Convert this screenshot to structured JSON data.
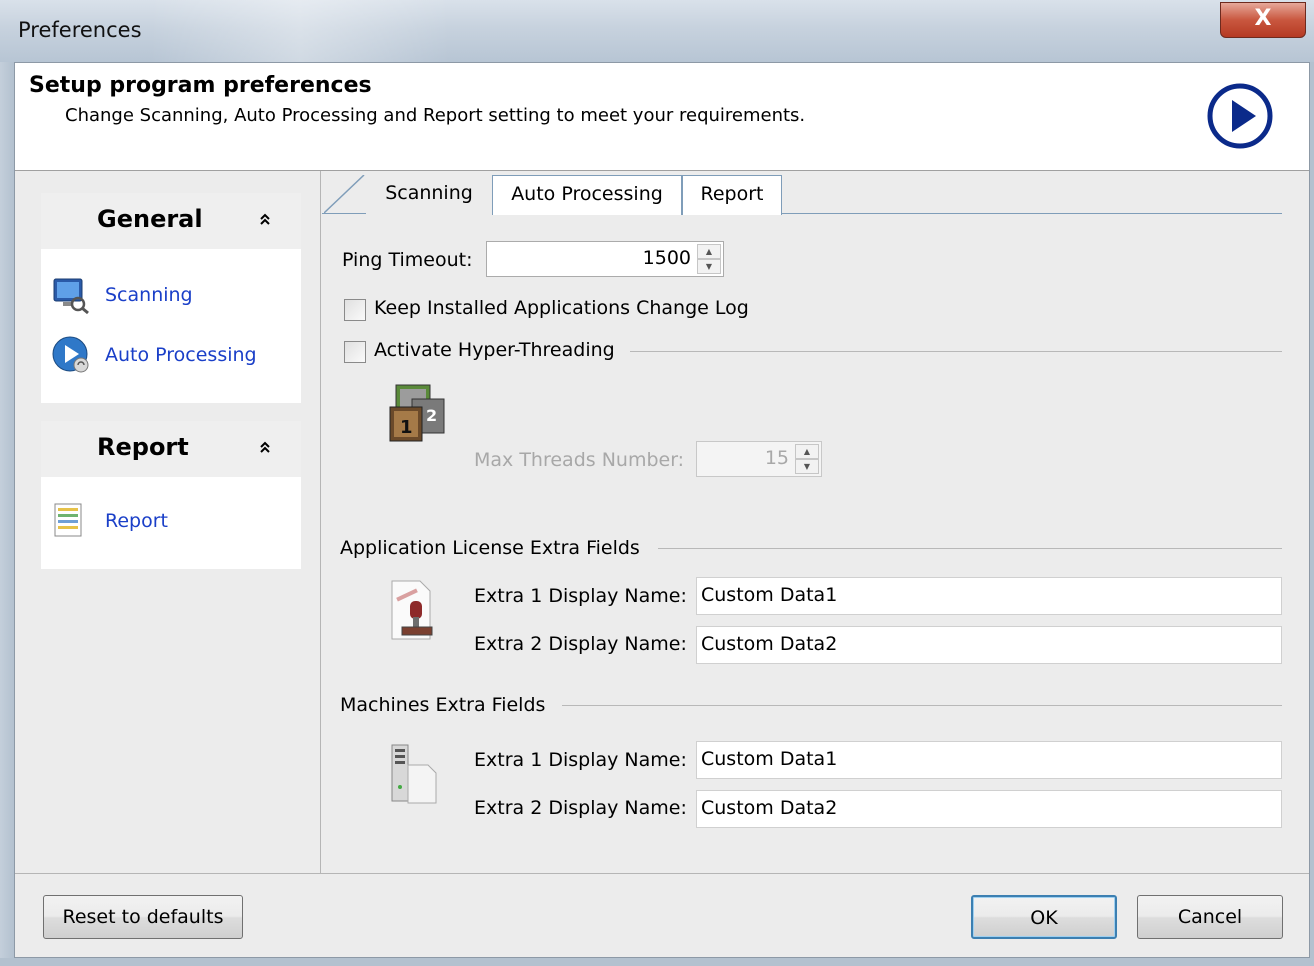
{
  "window": {
    "title": "Preferences",
    "close_label": "X"
  },
  "header": {
    "title": "Setup program preferences",
    "subtitle": "Change Scanning, Auto Processing and Report setting to meet your requirements."
  },
  "sidebar": {
    "groups": [
      {
        "title": "General",
        "toggle": "»",
        "items": [
          {
            "label": "Scanning",
            "icon": "monitor-magnifier-icon"
          },
          {
            "label": "Auto Processing",
            "icon": "auto-processing-icon"
          }
        ]
      },
      {
        "title": "Report",
        "toggle": "»",
        "items": [
          {
            "label": "Report",
            "icon": "report-icon"
          }
        ]
      }
    ]
  },
  "tabs": [
    {
      "label": "Scanning",
      "active": true
    },
    {
      "label": "Auto Processing",
      "active": false
    },
    {
      "label": "Report",
      "active": false
    }
  ],
  "scanning": {
    "ping_timeout_label": "Ping Timeout:",
    "ping_timeout_value": "1500",
    "keep_log_label": "Keep Installed Applications Change Log",
    "keep_log_checked": false,
    "hyper_threading_label": "Activate Hyper-Threading",
    "hyper_threading_checked": false,
    "max_threads_label": "Max Threads Number:",
    "max_threads_value": "15",
    "threads_icon_digits": [
      "1",
      "2"
    ],
    "app_license_section": "Application License Extra Fields",
    "app_extra1_label": "Extra 1 Display Name:",
    "app_extra1_value": "Custom Data1",
    "app_extra2_label": "Extra 2 Display Name:",
    "app_extra2_value": "Custom Data2",
    "machines_section": "Machines Extra Fields",
    "mach_extra1_label": "Extra 1 Display Name:",
    "mach_extra1_value": "Custom Data1",
    "mach_extra2_label": "Extra 2 Display Name:",
    "mach_extra2_value": "Custom Data2"
  },
  "footer": {
    "reset_label": "Reset to defaults",
    "ok_label": "OK",
    "cancel_label": "Cancel"
  },
  "colors": {
    "link": "#1a3fc8",
    "accent": "#0b2a8a"
  }
}
